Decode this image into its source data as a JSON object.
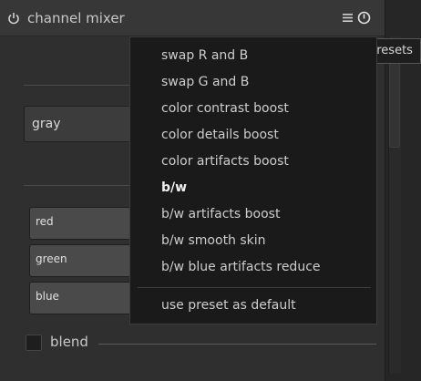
{
  "module": {
    "title": "channel mixer",
    "icons": {
      "power": "power-icon",
      "menu": "hamburger-menu-icon",
      "reset": "reset-icon"
    },
    "destination_combo": {
      "value": "gray"
    },
    "sliders": [
      {
        "label": "red"
      },
      {
        "label": "green"
      },
      {
        "label": "blue"
      }
    ],
    "blend": {
      "label": "blend",
      "checked": false
    }
  },
  "tooltip": {
    "text": "presets"
  },
  "presets_menu": {
    "items": [
      {
        "label": "swap R and B",
        "active": false
      },
      {
        "label": "swap G and B",
        "active": false
      },
      {
        "label": "color contrast boost",
        "active": false
      },
      {
        "label": "color details boost",
        "active": false
      },
      {
        "label": "color artifacts boost",
        "active": false
      },
      {
        "label": "b/w",
        "active": true
      },
      {
        "label": "b/w artifacts boost",
        "active": false
      },
      {
        "label": "b/w smooth skin",
        "active": false
      },
      {
        "label": "b/w blue artifacts reduce",
        "active": false
      }
    ],
    "default_action": "use preset as default"
  },
  "colors": {
    "panel_bg": "#2f2f2f",
    "header_bg": "#373737",
    "menu_bg": "#1a1a1a",
    "text": "#cdcdcd"
  }
}
